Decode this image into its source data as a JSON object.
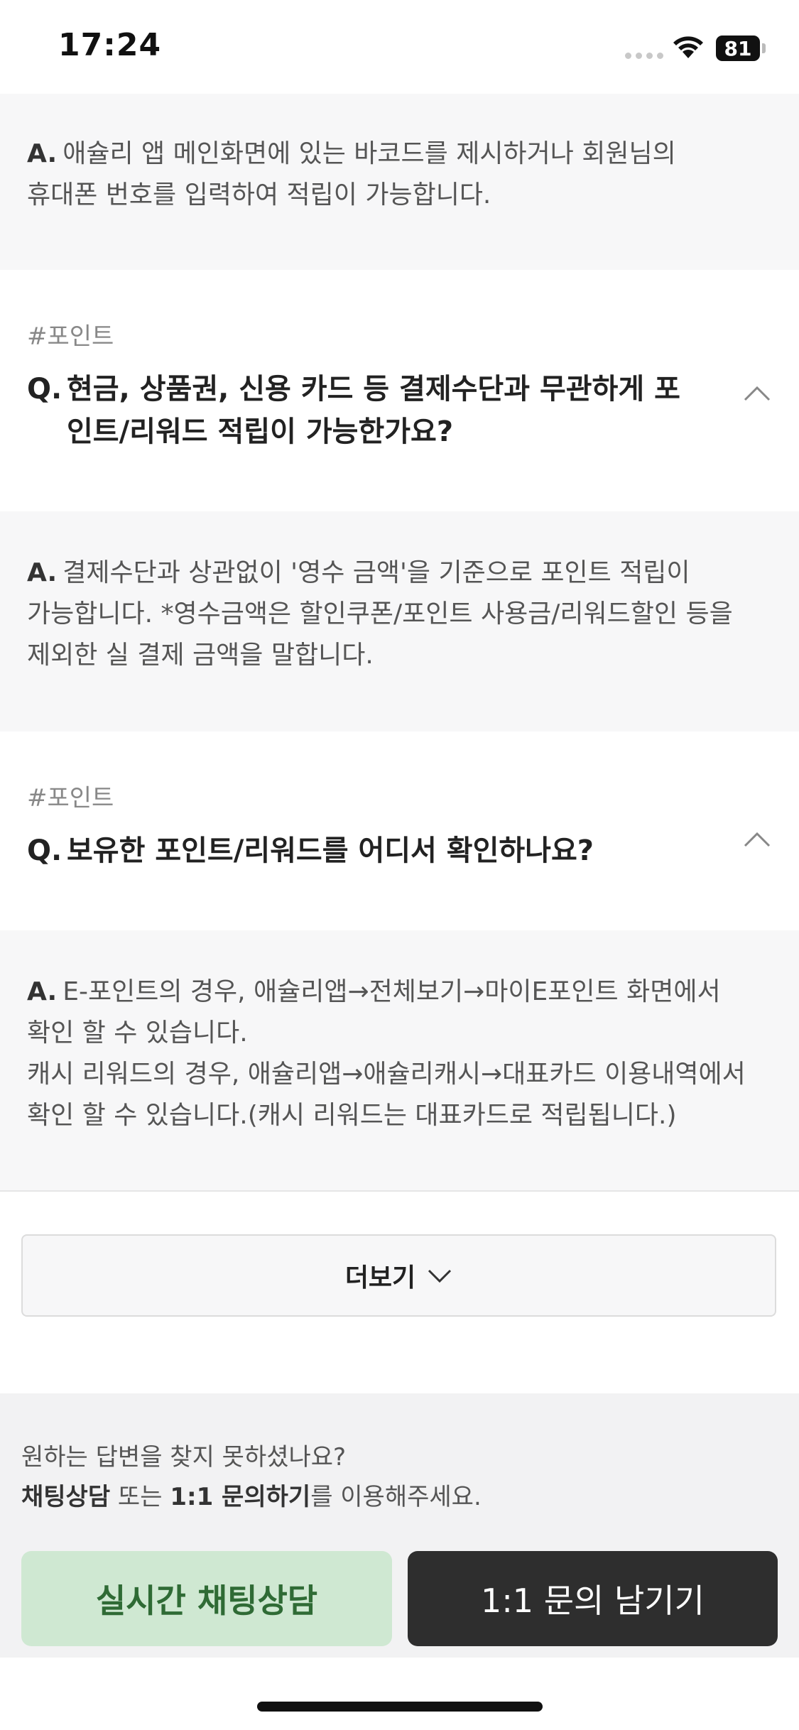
{
  "status_bar": {
    "time": "17:24",
    "battery": "81"
  },
  "faq": [
    {
      "answer_label": "A.",
      "answer": "애슐리 앱 메인화면에 있는 바코드를 제시하거나 회원님의\n휴대폰 번호를 입력하여 적립이 가능합니다."
    },
    {
      "tag": "#포인트",
      "question_label": "Q.",
      "question": "현금, 상품권, 신용 카드 등 결제수단과 무관하게 포인트/리워드 적립이 가능한가요?",
      "answer_label": "A.",
      "answer": "결제수단과 상관없이 '영수 금액'을 기준으로 포인트 적립이\n가능합니다. *영수금액은 할인쿠폰/포인트 사용금/리워드할인 등을\n제외한 실 결제 금액을 말합니다."
    },
    {
      "tag": "#포인트",
      "question_label": "Q.",
      "question": "보유한 포인트/리워드를 어디서 확인하나요?",
      "answer_label": "A.",
      "answer": "E-포인트의 경우, 애슐리앱→전체보기→마이E포인트 화면에서\n확인 할 수 있습니다.\n캐시 리워드의 경우, 애슐리앱→애슐리캐시→대표카드 이용내역에서\n확인 할 수 있습니다.(캐시 리워드는 대표카드로 적립됩니다.)"
    }
  ],
  "more_button": {
    "label": "더보기"
  },
  "help": {
    "line1": "원하는 답변을 찾지 못하셨나요?",
    "chat_word": "채팅상담",
    "connector": " 또는 ",
    "inquiry_word": "1:1 문의하기",
    "suffix": "를 이용해주세요."
  },
  "buttons": {
    "chat": "실시간 채팅상담",
    "inquiry": "1:1 문의 남기기"
  },
  "colors": {
    "chat_bg": "#cfe8d2",
    "chat_text": "#2f6b35",
    "inquiry_bg": "#2e2e2e"
  }
}
